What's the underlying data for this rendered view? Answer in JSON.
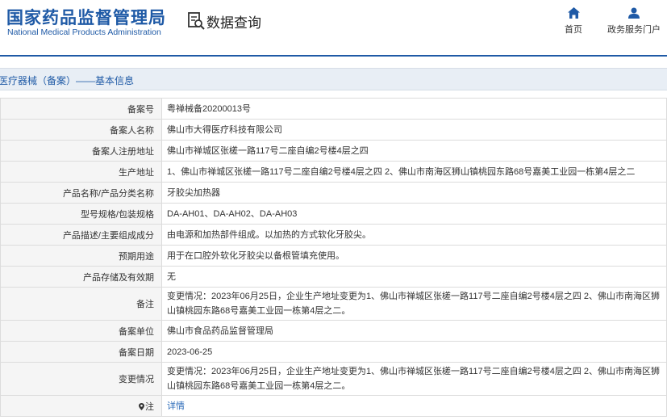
{
  "header": {
    "agency_name": "国家药品监督管理局",
    "agency_name_en": "National Medical Products Administration",
    "query_title": "数据查询",
    "nav": {
      "home_label": "首页",
      "portal_label": "政务服务门户"
    }
  },
  "section": {
    "title": "医疗器械（备案）——基本信息"
  },
  "rows": [
    {
      "label": "备案号",
      "value": "粤禅械备20200013号"
    },
    {
      "label": "备案人名称",
      "value": "佛山市大得医疗科技有限公司"
    },
    {
      "label": "备案人注册地址",
      "value": "佛山市禅城区张槎一路117号二座自编2号楼4层之四"
    },
    {
      "label": "生产地址",
      "value": "1、佛山市禅城区张槎一路117号二座自编2号楼4层之四 2、佛山市南海区狮山镇桃园东路68号嘉美工业园一栋第4层之二"
    },
    {
      "label": "产品名称/产品分类名称",
      "value": "牙胶尖加热器"
    },
    {
      "label": "型号规格/包装规格",
      "value": "DA-AH01、DA-AH02、DA-AH03"
    },
    {
      "label": "产品描述/主要组成成分",
      "value": "由电源和加热部件组成。以加热的方式软化牙胶尖。"
    },
    {
      "label": "预期用途",
      "value": "用于在口腔外软化牙胶尖以备根管填充使用。"
    },
    {
      "label": "产品存储及有效期",
      "value": "无"
    },
    {
      "label": "备注",
      "value": "变更情况：2023年06月25日，企业生产地址变更为1、佛山市禅城区张槎一路117号二座自编2号楼4层之四 2、佛山市南海区狮山镇桃园东路68号嘉美工业园一栋第4层之二。"
    },
    {
      "label": "备案单位",
      "value": "佛山市食品药品监督管理局"
    },
    {
      "label": "备案日期",
      "value": "2023-06-25"
    },
    {
      "label": "变更情况",
      "value": "变更情况：2023年06月25日，企业生产地址变更为1、佛山市禅城区张槎一路117号二座自编2号楼4层之四 2、佛山市南海区狮山镇桃园东路68号嘉美工业园一栋第4层之二。"
    },
    {
      "label": "注",
      "value": "详情"
    }
  ],
  "colors": {
    "brand_blue": "#1f5aa6",
    "link_blue": "#2a6ab8",
    "label_bg": "#f5f5f5",
    "section_bg": "#e8eef5"
  },
  "icons": {
    "query": "search-document-icon",
    "home": "home-icon",
    "portal": "user-icon",
    "note": "location-pin-icon"
  }
}
